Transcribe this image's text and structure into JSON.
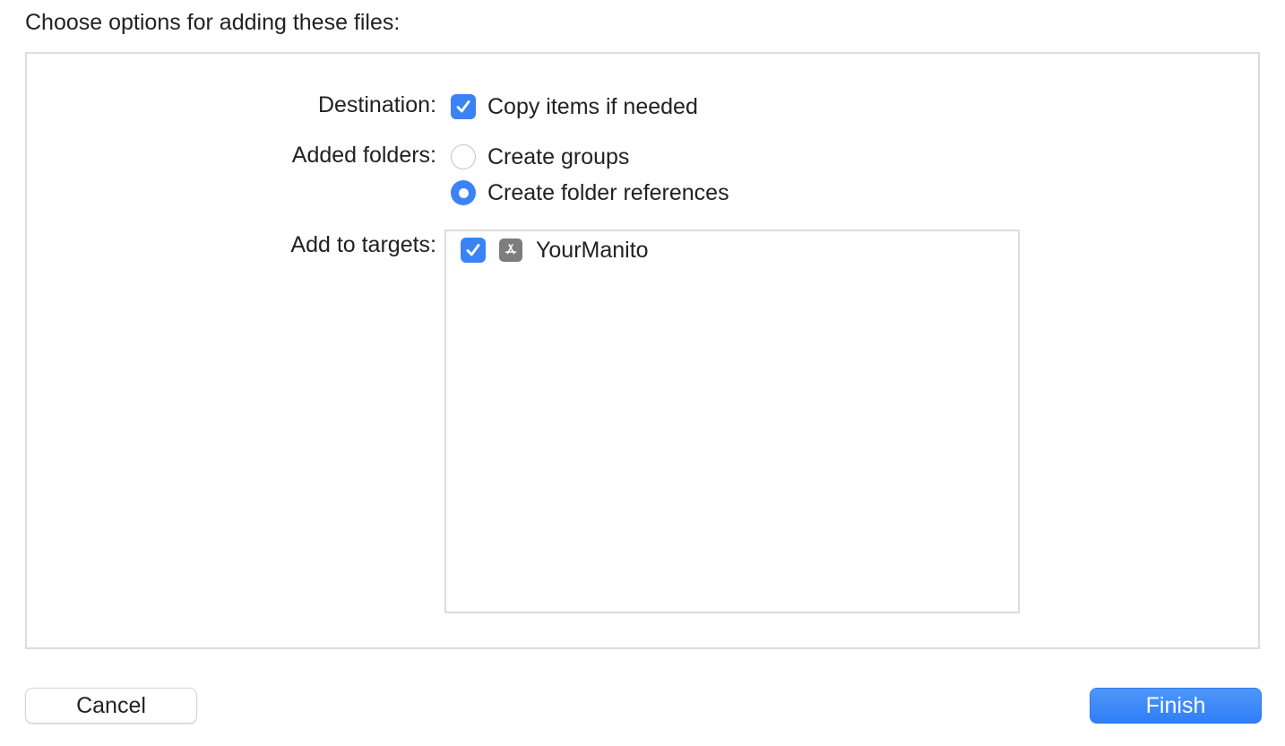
{
  "heading": "Choose options for adding these files:",
  "destination": {
    "label": "Destination:",
    "option_label": "Copy items if needed",
    "checked": true
  },
  "added_folders": {
    "label": "Added folders:",
    "options": [
      {
        "label": "Create groups",
        "selected": false
      },
      {
        "label": "Create folder references",
        "selected": true
      }
    ]
  },
  "targets": {
    "label": "Add to targets:",
    "items": [
      {
        "name": "YourManito",
        "checked": true,
        "icon": "app-store-icon"
      }
    ]
  },
  "buttons": {
    "cancel": "Cancel",
    "finish": "Finish"
  },
  "colors": {
    "accent": "#3b82f6",
    "border": "#dcdcdc",
    "icon_gray": "#7d7d7d"
  }
}
